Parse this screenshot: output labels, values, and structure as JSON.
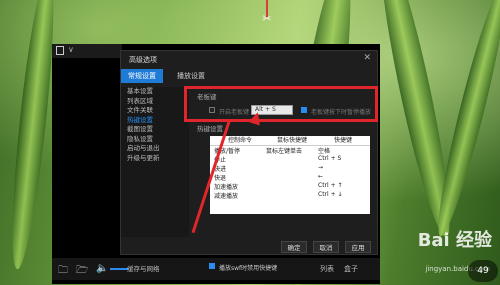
{
  "dialog": {
    "title": "高级选项",
    "close_icon": "close-icon",
    "tabs": [
      {
        "label": "常规设置"
      },
      {
        "label": "播放设置"
      }
    ],
    "sidebar": {
      "items": [
        {
          "label": "基本设置"
        },
        {
          "label": "列表区域"
        },
        {
          "label": "文件关联"
        },
        {
          "label": "热键设置"
        },
        {
          "label": "截图设置"
        },
        {
          "label": "隐私设置"
        },
        {
          "label": "启动与退出"
        },
        {
          "label": "升级与更新"
        }
      ],
      "bottom": "缓存与网络"
    },
    "boss_key": {
      "title": "老板键",
      "enable_label": "开启老板键",
      "hotkey_value": "Alt + S",
      "pause_label": "老板键按下时暂停播放"
    },
    "hotkeys": {
      "title": "热键设置",
      "headers": [
        "控制命令",
        "鼠标快捷键",
        "快捷键"
      ],
      "rows": [
        [
          "播放/暂停",
          "鼠标左键单击",
          "空格"
        ],
        [
          "停止",
          "",
          "Ctrl + S"
        ],
        [
          "快进",
          "",
          "→"
        ],
        [
          "快退",
          "",
          "←"
        ],
        [
          "加速播放",
          "",
          "Ctrl + ↑"
        ],
        [
          "减速播放",
          "",
          "Ctrl + ↓"
        ]
      ],
      "disable_label": "播放swf时禁用快捷键"
    },
    "buttons": {
      "ok": "确定",
      "cancel": "取消",
      "apply": "应用"
    }
  },
  "player": {
    "bottom": {
      "list_label": "列表",
      "box_label": "盒子"
    }
  },
  "watermark": {
    "text": "Bai 经验",
    "sub": "jingyan.baidu.com"
  },
  "clock": "49",
  "colors": {
    "accent": "#1f7bd6",
    "highlight_red": "#e0262b"
  }
}
